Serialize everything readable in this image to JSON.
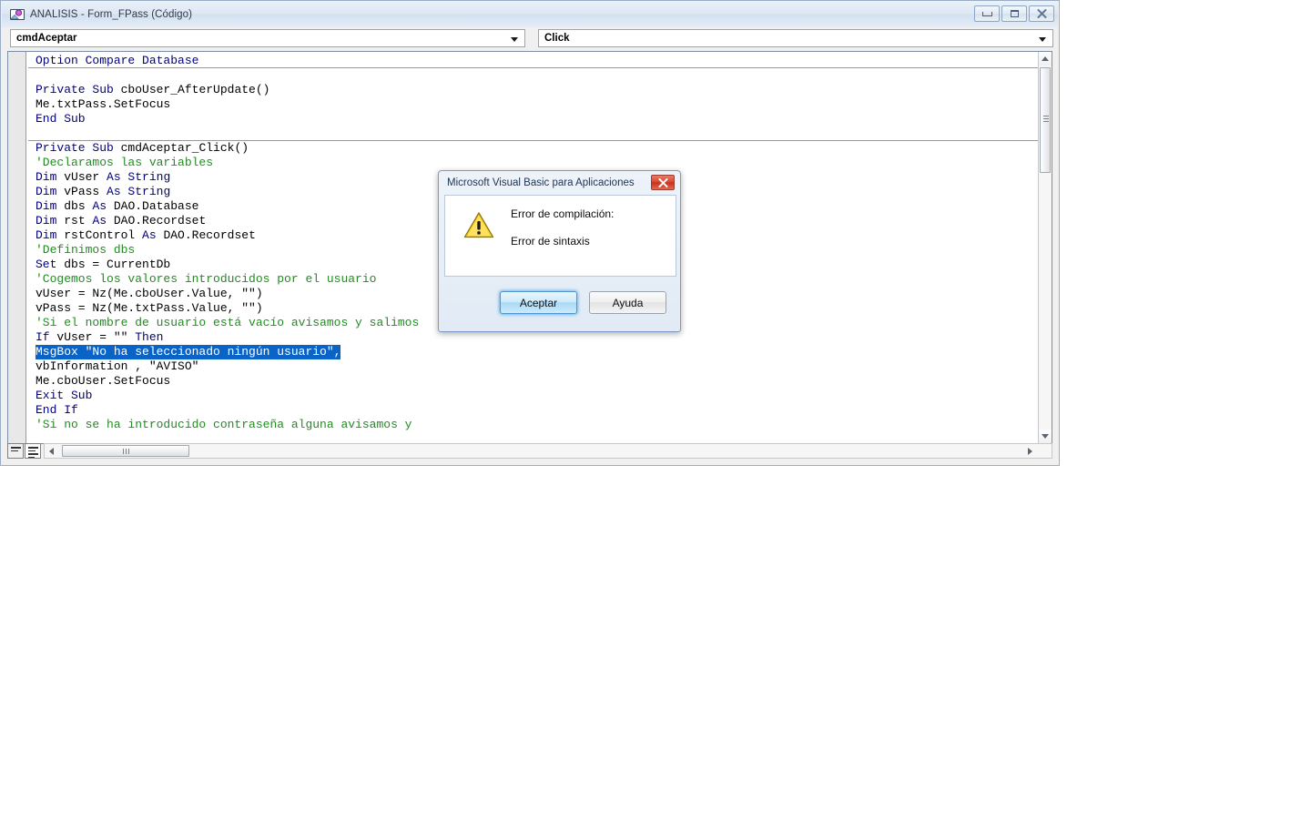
{
  "window": {
    "title": "ANALISIS - Form_FPass (Código)",
    "icon": "vba-module-icon",
    "buttons": {
      "minimize": "minimize-icon",
      "restore": "restore-icon",
      "close": "close-icon"
    }
  },
  "toolbar": {
    "object_combo": {
      "value": "cmdAceptar",
      "arrow": "chevron-down-icon"
    },
    "procedure_combo": {
      "value": "Click",
      "arrow": "chevron-down-icon"
    }
  },
  "code": {
    "lines": [
      [
        {
          "t": "Option Compare Database",
          "c": "kw"
        }
      ],
      [],
      [
        {
          "t": "Private Sub ",
          "c": "kw"
        },
        {
          "t": "cboUser_AfterUpdate()",
          "c": "id"
        }
      ],
      [
        {
          "t": "Me.txtPass.SetFocus",
          "c": "id"
        }
      ],
      [
        {
          "t": "End Sub",
          "c": "kw"
        }
      ],
      [],
      [
        {
          "t": "Private Sub ",
          "c": "kw"
        },
        {
          "t": "cmdAceptar_Click()",
          "c": "id"
        }
      ],
      [
        {
          "t": "'Declaramos las variables",
          "c": "cmt"
        }
      ],
      [
        {
          "t": "Dim ",
          "c": "kw"
        },
        {
          "t": "vUser ",
          "c": "id"
        },
        {
          "t": "As String",
          "c": "kw"
        }
      ],
      [
        {
          "t": "Dim ",
          "c": "kw"
        },
        {
          "t": "vPass ",
          "c": "id"
        },
        {
          "t": "As String",
          "c": "kw"
        }
      ],
      [
        {
          "t": "Dim ",
          "c": "kw"
        },
        {
          "t": "dbs ",
          "c": "id"
        },
        {
          "t": "As ",
          "c": "kw"
        },
        {
          "t": "DAO.Database",
          "c": "id"
        }
      ],
      [
        {
          "t": "Dim ",
          "c": "kw"
        },
        {
          "t": "rst ",
          "c": "id"
        },
        {
          "t": "As ",
          "c": "kw"
        },
        {
          "t": "DAO.Recordset",
          "c": "id"
        }
      ],
      [
        {
          "t": "Dim ",
          "c": "kw"
        },
        {
          "t": "rstControl ",
          "c": "id"
        },
        {
          "t": "As ",
          "c": "kw"
        },
        {
          "t": "DAO.Recordset",
          "c": "id"
        }
      ],
      [
        {
          "t": "'Definimos dbs",
          "c": "cmt"
        }
      ],
      [
        {
          "t": "Set ",
          "c": "kw"
        },
        {
          "t": "dbs = CurrentDb",
          "c": "id"
        }
      ],
      [
        {
          "t": "'Cogemos los valores introducidos por el usuario",
          "c": "cmt"
        }
      ],
      [
        {
          "t": "vUser = Nz(Me.cboUser.Value, \"\")",
          "c": "id"
        }
      ],
      [
        {
          "t": "vPass = Nz(Me.txtPass.Value, \"\")",
          "c": "id"
        }
      ],
      [
        {
          "t": "'Si el nombre de usuario está vacío avisamos y salimos",
          "c": "cmt"
        }
      ],
      [
        {
          "t": "If ",
          "c": "kw"
        },
        {
          "t": "vUser = \"\" ",
          "c": "id"
        },
        {
          "t": "Then",
          "c": "kw"
        }
      ],
      [
        {
          "t": "MsgBox \"No ha seleccionado ningún usuario\",",
          "c": "sel"
        }
      ],
      [
        {
          "t": "vbInformation , \"AVISO\"",
          "c": "id"
        }
      ],
      [
        {
          "t": "Me.cboUser.SetFocus",
          "c": "id"
        }
      ],
      [
        {
          "t": "Exit Sub",
          "c": "kw"
        }
      ],
      [
        {
          "t": "End If",
          "c": "kw"
        }
      ],
      [
        {
          "t": "'Si no se ha introducido contraseña alguna avisamos y",
          "c": "cmt"
        }
      ]
    ],
    "separators_after_line": [
      0,
      5
    ],
    "selected_line_index": 20,
    "selected_text": "MsgBox \"No ha seleccionado ningún usuario\","
  },
  "scrollbars": {
    "vertical": {
      "up_arrow": "arrow-up-icon",
      "down_arrow": "arrow-down-icon",
      "thumb": "vertical-scroll-thumb"
    },
    "horizontal": {
      "left_arrow": "arrow-left-icon",
      "right_arrow": "arrow-right-icon",
      "thumb": "horizontal-scroll-thumb"
    }
  },
  "view_buttons": {
    "procedure_view": "procedure-view-icon",
    "full_module_view": "full-module-view-icon"
  },
  "dialog": {
    "title": "Microsoft Visual Basic para Aplicaciones",
    "close_icon": "close-icon",
    "warning_icon": "warning-triangle-icon",
    "message_line1": "Error de compilación:",
    "message_line2": "Error de sintaxis",
    "buttons": {
      "ok": "Aceptar",
      "help": "Ayuda"
    }
  },
  "colors": {
    "keyword": "#00007f",
    "comment": "#228b22",
    "identifier": "#000000",
    "selection_bg": "#0a64c8",
    "selection_fg": "#ffffff",
    "dialog_close_red": "#d9442e",
    "warning_yellow": "#ffd42a"
  }
}
